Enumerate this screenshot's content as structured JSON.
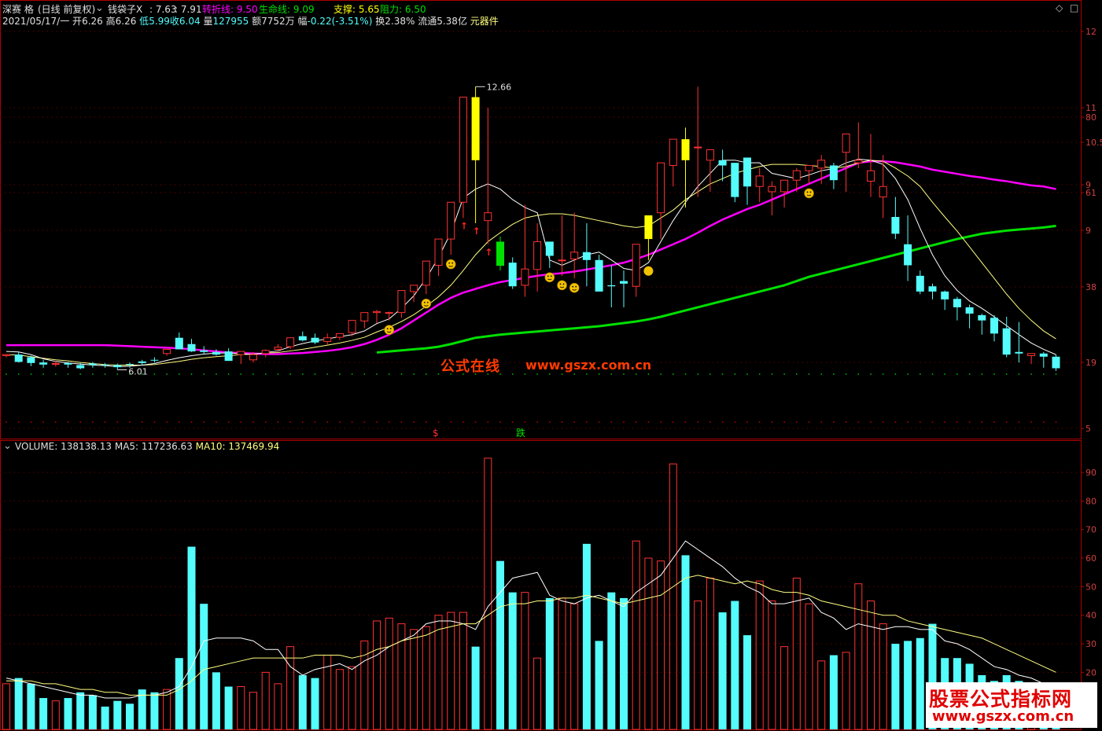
{
  "header": {
    "stock_name": "深赛 格",
    "period_mode": "(日线 前复权)",
    "indicator": {
      "name": "钱袋子X",
      "v1": "7.63",
      "v2": "7.91",
      "turn_label": "转折线",
      "turn_value": "9.50",
      "life_label": "生命线",
      "life_value": "9.09",
      "support_label": "支撑",
      "support_value": "5.65",
      "resist_label": "阻力",
      "resist_value": "6.50"
    },
    "info": {
      "date": "2021/05/17/一",
      "open_label": "开",
      "open": "6.26",
      "high_label": "高",
      "high": "6.26",
      "low_label": "低",
      "low": "5.99",
      "close_label": "收",
      "close": "6.04",
      "volume_label": "量",
      "volume": "127955",
      "amount_label": "额",
      "amount": "7752万",
      "change_label": "幅",
      "change": "-0.22(-3.51%)",
      "turnover_label": "换",
      "turnover": "2.38%",
      "float_label": "流通",
      "float": "5.38亿",
      "concept": "元器件"
    }
  },
  "price_panel": {
    "axis_ticks": [
      "12",
      "11",
      "80",
      "10.5",
      "9",
      "61",
      "9",
      "38",
      "19",
      "5"
    ],
    "max_label": "12.66",
    "min_label": "6.01",
    "signal_buy": "$",
    "signal_fall": "跌"
  },
  "volume_panel": {
    "label": "VOLUME",
    "volume": "138138.13",
    "ma5_label": "MA5",
    "ma5": "117236.63",
    "ma10_label": "MA10",
    "ma10": "137469.94",
    "axis_ticks": [
      "90",
      "80",
      "70",
      "60",
      "50",
      "40",
      "30",
      "20"
    ]
  },
  "watermark": {
    "cn": "公式在线",
    "url": "www.gszx.com.cn"
  },
  "brand": {
    "title": "股票公式指标网",
    "url": "www.gszx.com.cn"
  },
  "colors": {
    "up": "#ff3232",
    "down": "#54fcfc",
    "ma_short": "#ffffff",
    "ma_mid": "#ffff80",
    "turn_line": "#ff00ff",
    "life_line": "#00e000",
    "vol_ma5": "#ffffff",
    "vol_ma10": "#ffff80"
  },
  "chart_data": [
    {
      "type": "candlestick",
      "x": [
        "1",
        "2",
        "3",
        "4",
        "5",
        "6",
        "7",
        "8",
        "9",
        "10",
        "11",
        "12",
        "13",
        "14",
        "15",
        "16",
        "17",
        "18",
        "19",
        "20",
        "21",
        "22",
        "23",
        "24",
        "25",
        "26",
        "27",
        "28",
        "29",
        "30",
        "31",
        "32",
        "33",
        "34",
        "35",
        "36",
        "37",
        "38",
        "39",
        "40",
        "41",
        "42",
        "43",
        "44",
        "45",
        "46",
        "47",
        "48",
        "49",
        "50",
        "51",
        "52",
        "53",
        "54",
        "55",
        "56",
        "57",
        "58",
        "59",
        "60",
        "61",
        "62",
        "63",
        "64",
        "65",
        "66",
        "67",
        "68",
        "69",
        "70",
        "71",
        "72",
        "73",
        "74",
        "75",
        "76",
        "77",
        "78",
        "79",
        "80",
        "81",
        "82",
        "83",
        "84",
        "85",
        "86"
      ],
      "open": [
        6.28,
        6.3,
        6.25,
        6.15,
        6.13,
        6.14,
        6.1,
        6.13,
        6.11,
        6.1,
        6.12,
        6.17,
        6.2,
        6.32,
        6.62,
        6.5,
        6.38,
        6.35,
        6.36,
        6.3,
        6.2,
        6.32,
        6.4,
        6.45,
        6.65,
        6.62,
        6.55,
        6.63,
        6.72,
        6.94,
        7.1,
        7.1,
        7.1,
        7.5,
        7.62,
        8.0,
        8.5,
        9.2,
        11.2,
        8.85,
        8.45,
        8.05,
        7.62,
        7.92,
        8.45,
        8.1,
        8.12,
        8.25,
        8.1,
        7.62,
        7.7,
        7.6,
        8.5,
        9.0,
        9.9,
        10.4,
        10.25,
        10.0,
        10.0,
        9.95,
        10.05,
        9.5,
        9.4,
        9.4,
        9.62,
        9.8,
        9.85,
        9.9,
        10.15,
        9.95,
        9.6,
        9.3,
        8.92,
        8.4,
        7.8,
        7.6,
        7.5,
        7.36,
        7.2,
        7.05,
        7.0,
        6.8,
        6.35,
        6.28,
        6.32,
        6.26
      ],
      "high": [
        6.3,
        6.35,
        6.28,
        6.2,
        6.18,
        6.16,
        6.14,
        6.16,
        6.14,
        6.13,
        6.15,
        6.2,
        6.25,
        6.4,
        6.72,
        6.6,
        6.46,
        6.4,
        6.42,
        6.36,
        6.35,
        6.4,
        6.5,
        6.55,
        6.74,
        6.7,
        6.7,
        6.7,
        6.8,
        7.05,
        7.15,
        7.12,
        7.15,
        7.55,
        7.7,
        8.1,
        8.6,
        9.3,
        11.4,
        11.0,
        8.55,
        8.15,
        9.15,
        8.8,
        8.4,
        8.95,
        9.0,
        8.8,
        8.2,
        8.0,
        7.9,
        7.8,
        8.7,
        9.2,
        10.05,
        10.62,
        11.4,
        10.0,
        10.2,
        9.95,
        10.05,
        9.85,
        9.6,
        9.6,
        9.85,
        9.85,
        10.1,
        9.95,
        10.15,
        10.72,
        10.5,
        10.1,
        9.3,
        8.95,
        7.9,
        7.65,
        7.52,
        7.4,
        7.25,
        7.08,
        7.05,
        7.02,
        6.92,
        6.3,
        6.35,
        6.3
      ],
      "low": [
        6.25,
        6.15,
        6.08,
        6.05,
        6.07,
        6.05,
        6.02,
        6.05,
        6.05,
        6.01,
        6.05,
        6.1,
        6.15,
        6.28,
        6.48,
        6.35,
        6.3,
        6.28,
        6.18,
        6.12,
        6.15,
        6.25,
        6.35,
        6.4,
        6.55,
        6.5,
        6.48,
        6.58,
        6.65,
        6.8,
        6.9,
        6.95,
        7.0,
        7.3,
        7.45,
        7.8,
        8.2,
        8.9,
        8.8,
        8.4,
        7.9,
        7.55,
        7.4,
        7.5,
        7.95,
        7.8,
        7.75,
        7.6,
        7.55,
        7.2,
        7.2,
        7.4,
        8.1,
        8.5,
        9.5,
        9.1,
        9.3,
        9.4,
        9.6,
        9.2,
        9.15,
        9.2,
        8.95,
        9.1,
        9.4,
        9.55,
        9.55,
        9.45,
        9.4,
        9.85,
        9.3,
        8.9,
        8.5,
        7.7,
        7.45,
        7.35,
        7.15,
        6.95,
        6.8,
        6.68,
        6.55,
        6.25,
        6.15,
        6.12,
        6.05,
        5.99
      ],
      "close": [
        6.3,
        6.16,
        6.14,
        6.11,
        6.13,
        6.11,
        6.04,
        6.1,
        6.1,
        6.06,
        6.11,
        6.14,
        6.19,
        6.4,
        6.4,
        6.36,
        6.35,
        6.3,
        6.18,
        6.36,
        6.3,
        6.38,
        6.44,
        6.62,
        6.57,
        6.53,
        6.62,
        6.7,
        6.95,
        7.1,
        7.12,
        7.1,
        7.52,
        7.62,
        8.08,
        8.5,
        9.2,
        11.2,
        10.0,
        9.0,
        7.99,
        7.6,
        7.93,
        8.45,
        8.18,
        8.1,
        8.25,
        8.1,
        7.5,
        7.6,
        7.65,
        8.4,
        8.95,
        9.95,
        10.4,
        10.0,
        10.25,
        10.2,
        9.9,
        9.3,
        9.5,
        9.7,
        9.5,
        9.62,
        9.8,
        9.9,
        10.0,
        9.62,
        10.5,
        10.0,
        9.8,
        9.5,
        8.6,
        8.0,
        7.5,
        7.5,
        7.35,
        7.2,
        7.08,
        6.95,
        6.7,
        6.3,
        6.32,
        6.32,
        6.26,
        6.04
      ],
      "ma_short": [
        6.36,
        6.35,
        6.3,
        6.22,
        6.17,
        6.14,
        6.12,
        6.1,
        6.09,
        6.07,
        6.08,
        6.1,
        6.13,
        6.19,
        6.24,
        6.28,
        6.31,
        6.33,
        6.33,
        6.32,
        6.3,
        6.34,
        6.37,
        6.45,
        6.51,
        6.56,
        6.6,
        6.64,
        6.68,
        6.75,
        6.89,
        6.98,
        7.18,
        7.42,
        7.75,
        8.15,
        8.62,
        9.28,
        9.45,
        9.55,
        9.45,
        9.25,
        9.1,
        9.0,
        8.1,
        8.0,
        8.1,
        8.2,
        8.25,
        8.1,
        7.94,
        7.9,
        8.05,
        8.45,
        8.85,
        9.2,
        9.5,
        9.75,
        10.0,
        10.0,
        9.95,
        9.95,
        9.75,
        9.7,
        9.65,
        9.72,
        9.8,
        9.84,
        9.95,
        10.02,
        10.0,
        9.92,
        9.65,
        9.25,
        8.7,
        8.2,
        7.8,
        7.52,
        7.32,
        7.18,
        7.02,
        6.85,
        6.68,
        6.52,
        6.4,
        6.3
      ],
      "ma_mid": [
        6.3,
        6.29,
        6.26,
        6.23,
        6.2,
        6.18,
        6.15,
        6.13,
        6.11,
        6.1,
        6.1,
        6.1,
        6.11,
        6.14,
        6.17,
        6.21,
        6.24,
        6.26,
        6.28,
        6.3,
        6.31,
        6.33,
        6.34,
        6.37,
        6.4,
        6.44,
        6.48,
        6.52,
        6.57,
        6.63,
        6.73,
        6.82,
        6.93,
        7.06,
        7.22,
        7.4,
        7.62,
        7.9,
        8.2,
        8.45,
        8.62,
        8.78,
        8.9,
        8.95,
        8.98,
        8.98,
        8.95,
        8.9,
        8.85,
        8.8,
        8.75,
        8.72,
        8.75,
        8.9,
        9.05,
        9.25,
        9.4,
        9.55,
        9.65,
        9.75,
        9.82,
        9.88,
        9.92,
        9.92,
        9.92,
        9.9,
        9.88,
        9.85,
        9.88,
        9.95,
        10.0,
        9.98,
        9.85,
        9.7,
        9.5,
        9.2,
        8.92,
        8.65,
        8.35,
        8.05,
        7.75,
        7.45,
        7.18,
        6.95,
        6.75,
        6.6
      ],
      "turn_line": [
        6.48,
        6.48,
        6.48,
        6.48,
        6.48,
        6.48,
        6.48,
        6.48,
        6.48,
        6.47,
        6.46,
        6.45,
        6.44,
        6.43,
        6.42,
        6.4,
        6.38,
        6.36,
        6.34,
        6.33,
        6.32,
        6.31,
        6.31,
        6.32,
        6.33,
        6.35,
        6.37,
        6.4,
        6.44,
        6.5,
        6.58,
        6.68,
        6.8,
        6.95,
        7.1,
        7.25,
        7.38,
        7.48,
        7.55,
        7.62,
        7.68,
        7.72,
        7.76,
        7.8,
        7.83,
        7.85,
        7.88,
        7.92,
        7.96,
        8.0,
        8.05,
        8.12,
        8.2,
        8.3,
        8.4,
        8.5,
        8.62,
        8.75,
        8.87,
        8.97,
        9.07,
        9.15,
        9.25,
        9.35,
        9.45,
        9.55,
        9.65,
        9.75,
        9.85,
        9.95,
        9.98,
        9.98,
        9.96,
        9.92,
        9.88,
        9.82,
        9.78,
        9.74,
        9.7,
        9.67,
        9.63,
        9.6,
        9.56,
        9.52,
        9.5,
        9.45
      ],
      "life_line": [
        null,
        null,
        null,
        null,
        null,
        null,
        null,
        null,
        null,
        null,
        null,
        null,
        null,
        null,
        null,
        null,
        null,
        null,
        null,
        null,
        null,
        null,
        null,
        null,
        null,
        null,
        null,
        null,
        null,
        null,
        6.34,
        6.36,
        6.38,
        6.4,
        6.42,
        6.45,
        6.5,
        6.56,
        6.62,
        6.65,
        6.68,
        6.7,
        6.72,
        6.74,
        6.76,
        6.78,
        6.8,
        6.82,
        6.84,
        6.87,
        6.9,
        6.93,
        6.97,
        7.02,
        7.08,
        7.14,
        7.2,
        7.26,
        7.32,
        7.38,
        7.44,
        7.5,
        7.56,
        7.62,
        7.7,
        7.78,
        7.84,
        7.9,
        7.96,
        8.02,
        8.08,
        8.14,
        8.2,
        8.26,
        8.32,
        8.38,
        8.44,
        8.5,
        8.55,
        8.6,
        8.63,
        8.66,
        8.68,
        8.7,
        8.72,
        8.75
      ],
      "support": 6.42,
      "resist": 5.65,
      "max": 12.66,
      "min": 6.01
    },
    {
      "type": "bar",
      "title": "VOLUME",
      "values": [
        16,
        18,
        16,
        11,
        10,
        11,
        13,
        12,
        8,
        10,
        9,
        14,
        13,
        14,
        25,
        64,
        44,
        20,
        15,
        15,
        13,
        20,
        16,
        29,
        19,
        18,
        26,
        21,
        22,
        31,
        38,
        39,
        37,
        35,
        36,
        40,
        41,
        41,
        29,
        95,
        59,
        48,
        48,
        25,
        46,
        46,
        44,
        65,
        31,
        48,
        46,
        66,
        60,
        59,
        93,
        61,
        45,
        53,
        41,
        45,
        33,
        52,
        45,
        29,
        53,
        44,
        24,
        26,
        27,
        51,
        45,
        37,
        30,
        31,
        32,
        37,
        25,
        25,
        23,
        19,
        17,
        19,
        17,
        16,
        14,
        13
      ],
      "vol_ma5": [
        18,
        17,
        16,
        15,
        14,
        13,
        12,
        12,
        11,
        11,
        11,
        12,
        12,
        13,
        15,
        22,
        31,
        32,
        32,
        32,
        31,
        28,
        28,
        22,
        19,
        21,
        22,
        23,
        21,
        24,
        26,
        29,
        31,
        33,
        37,
        38,
        38,
        37,
        35,
        43,
        48,
        53,
        54,
        55,
        47,
        45,
        44,
        46,
        47,
        45,
        43,
        48,
        51,
        54,
        60,
        66,
        63,
        60,
        57,
        53,
        50,
        48,
        44,
        44,
        45,
        46,
        41,
        39,
        35,
        37,
        36,
        35,
        36,
        36,
        35,
        35,
        31,
        30,
        28,
        25,
        22,
        21,
        19,
        18,
        16,
        15
      ],
      "vol_ma10": [
        17,
        17,
        17,
        16,
        16,
        15,
        14,
        14,
        13,
        13,
        12,
        12,
        12,
        12,
        14,
        17,
        21,
        22,
        23,
        24,
        25,
        25,
        25,
        25,
        25,
        26,
        26,
        26,
        25,
        26,
        28,
        29,
        31,
        32,
        33,
        35,
        36,
        37,
        37,
        40,
        43,
        44,
        44,
        45,
        45,
        46,
        46,
        47,
        46,
        45,
        44,
        45,
        46,
        47,
        50,
        53,
        54,
        53,
        52,
        51,
        52,
        51,
        49,
        48,
        48,
        47,
        45,
        44,
        43,
        42,
        41,
        40,
        40,
        38,
        37,
        36,
        35,
        34,
        33,
        32,
        30,
        28,
        26,
        24,
        22,
        20
      ]
    }
  ]
}
